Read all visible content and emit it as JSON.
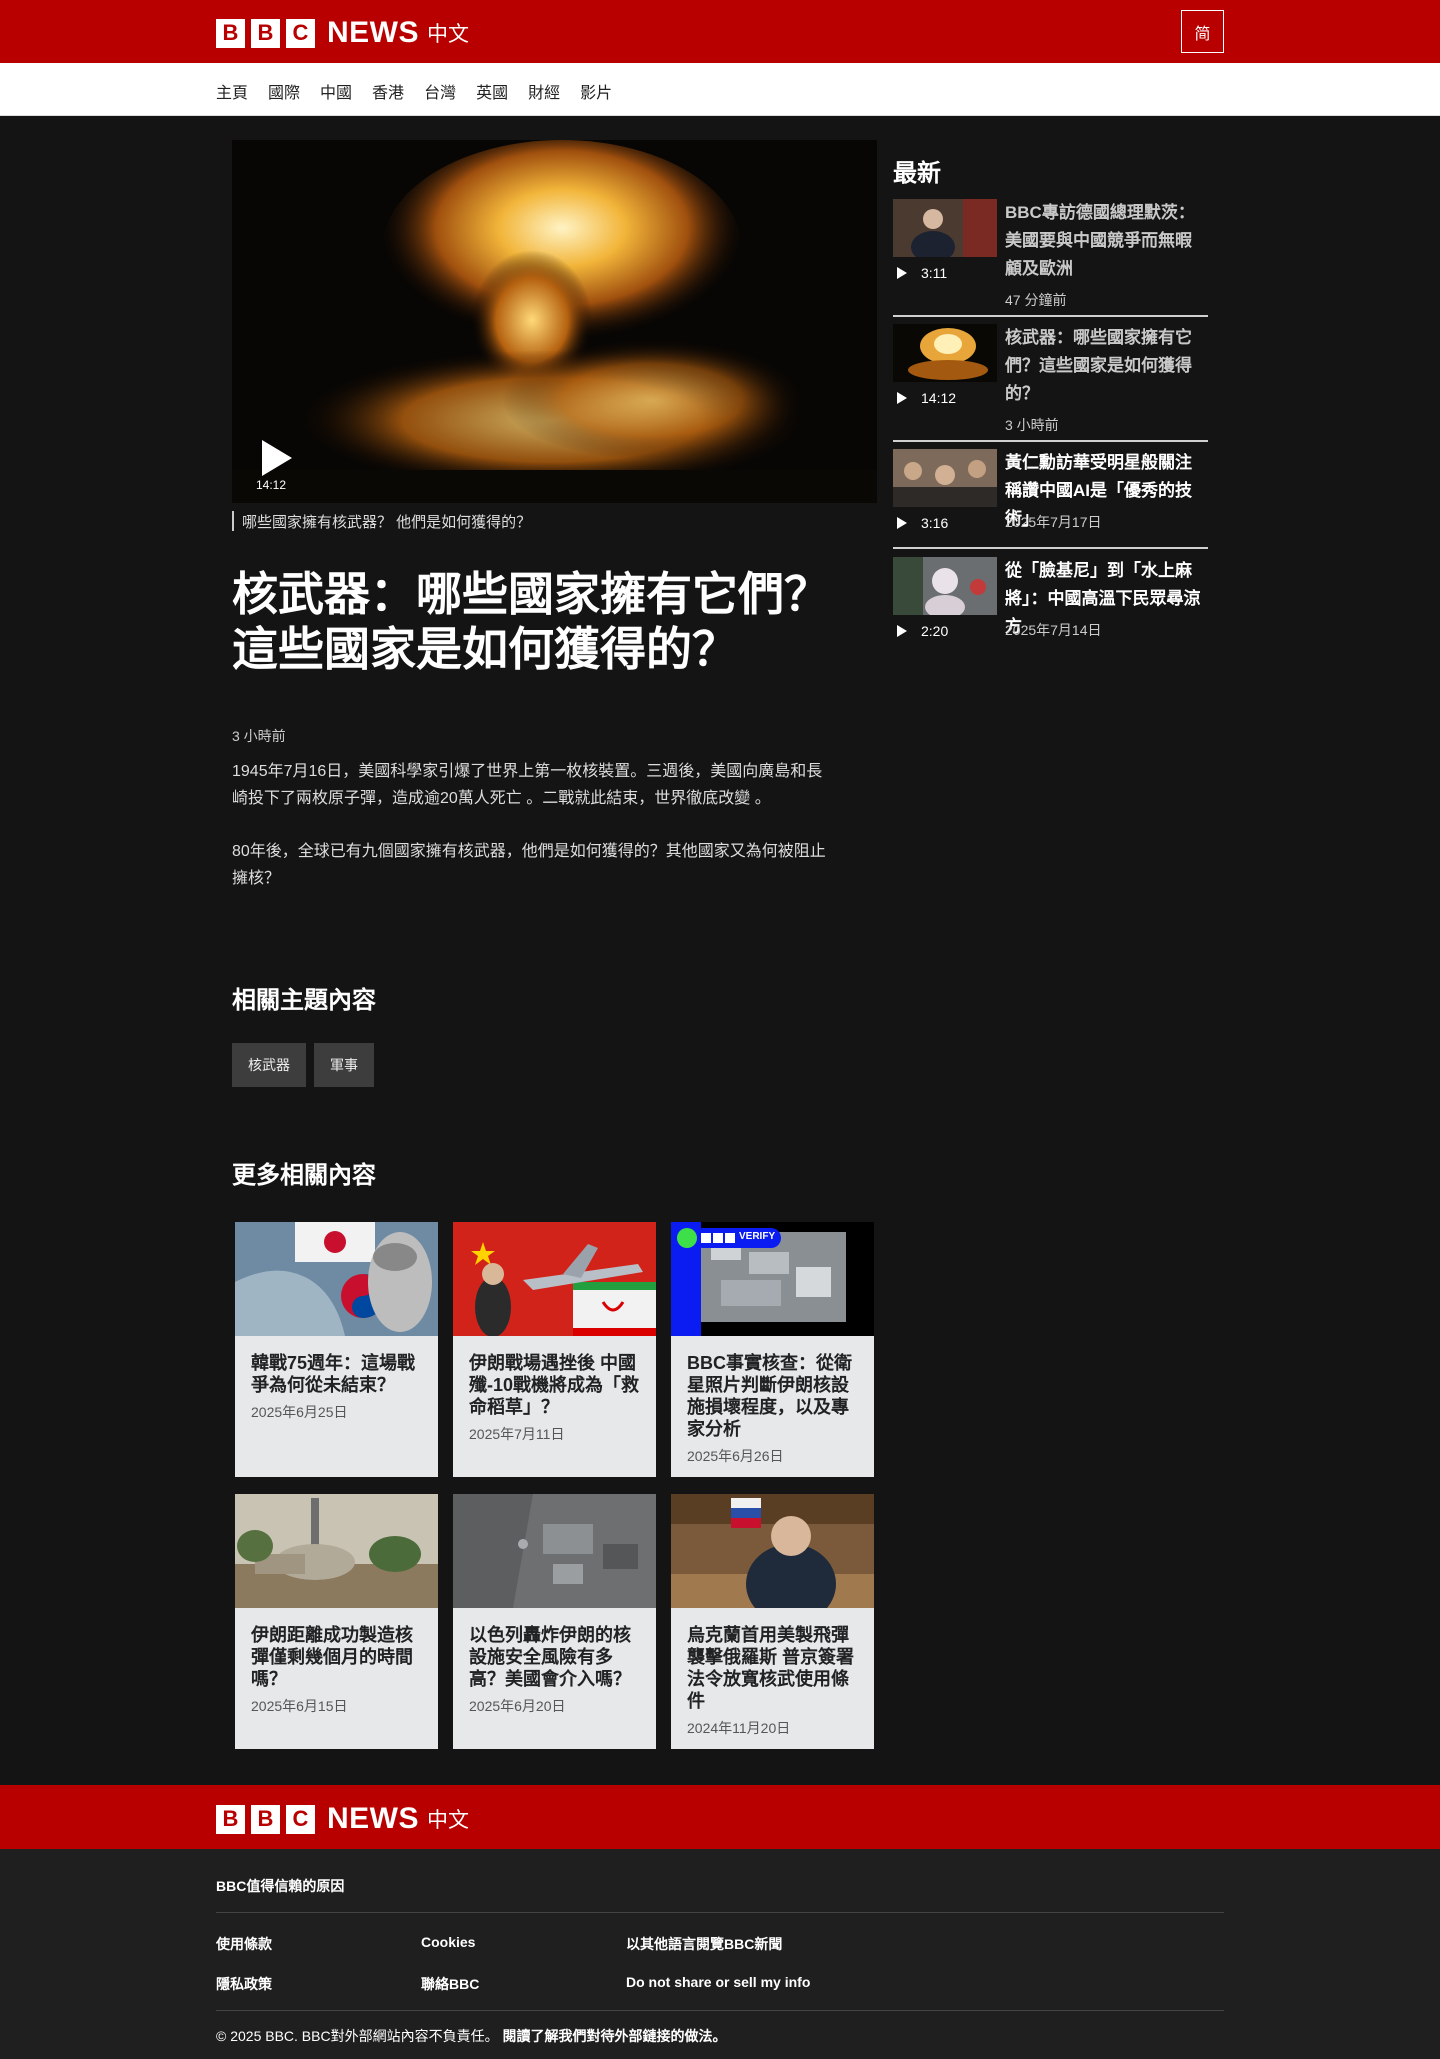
{
  "header": {
    "logo_letters": [
      "B",
      "B",
      "C"
    ],
    "logo_news": "NEWS",
    "logo_lang": "中文",
    "script_toggle": "简"
  },
  "nav": {
    "items": [
      "主頁",
      "國際",
      "中國",
      "香港",
      "台灣",
      "英國",
      "財經",
      "影片"
    ]
  },
  "article": {
    "video_duration": "14:12",
    "video_caption": "哪些國家擁有核武器？ 他們是如何獲得的？",
    "headline": "核武器：哪些國家擁有它們？這些國家是如何獲得的？",
    "time_ago": "3 小時前",
    "paragraphs": [
      "1945年7月16日，美國科學家引爆了世界上第一枚核裝置。三週後，美國向廣島和長崎投下了兩枚原子彈，造成逾20萬人死亡 。二戰就此結束，世界徹底改變 。",
      "80年後，全球已有九個國家擁有核武器，他們是如何獲得的？其他國家又為何被阻止擁核？"
    ]
  },
  "related_topics": {
    "title": "相關主題內容",
    "tags": [
      "核武器",
      "軍事"
    ]
  },
  "more_related": {
    "title": "更多相關內容",
    "cards": [
      {
        "title": "韓戰75週年：這場戰爭為何從未結束？",
        "date": "2025年6月25日"
      },
      {
        "title": "伊朗戰場遇挫後 中國殲-10戰機將成為「救命稻草」？",
        "date": "2025年7月11日"
      },
      {
        "title": "BBC事實核查：從衛星照片判斷伊朗核設施損壞程度，以及專家分析",
        "date": "2025年6月26日",
        "badge": "VERIFY"
      },
      {
        "title": "伊朗距離成功製造核彈僅剩幾個月的時間嗎？",
        "date": "2025年6月15日"
      },
      {
        "title": "以色列轟炸伊朗的核設施安全風險有多高？美國會介入嗎？",
        "date": "2025年6月20日"
      },
      {
        "title": "烏克蘭首用美製飛彈襲擊俄羅斯 普京簽署法令放寬核武使用條件",
        "date": "2024年11月20日"
      }
    ]
  },
  "sidebar": {
    "title": "最新",
    "items": [
      {
        "title": "BBC專訪德國總理默茨：美國要與中國競爭而無暇顧及歐洲",
        "duration": "3:11",
        "date": "47 分鐘前"
      },
      {
        "title": "核武器：哪些國家擁有它們？這些國家是如何獲得的？",
        "duration": "14:12",
        "date": "3 小時前"
      },
      {
        "title": "黃仁勳訪華受明星般關注 稱讚中國AI是「優秀的技術」",
        "duration": "3:16",
        "date": "2025年7月17日"
      },
      {
        "title": "從「臉基尼」到「水上麻將」：中國高溫下民眾尋涼方",
        "duration": "2:20",
        "date": "2025年7月14日"
      }
    ]
  },
  "footer": {
    "trust": "BBC值得信賴的原因",
    "links": [
      "使用條款",
      "Cookies",
      "以其他語言閱覽BBC新聞",
      "隱私政策",
      "聯絡BBC",
      "Do not share or sell my info"
    ],
    "copyright": "© 2025 BBC. BBC對外部網站內容不負責任。",
    "copyright_link": "閱讀了解我們對待外部鏈接的做法。"
  },
  "colors": {
    "brand_red": "#b80000",
    "page_bg": "#141414",
    "card_bg": "#e6e8ea",
    "verify_blue": "#0a1cf2"
  }
}
